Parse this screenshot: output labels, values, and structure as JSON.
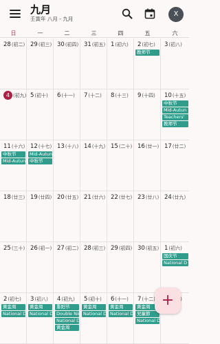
{
  "header": {
    "title": "九月",
    "subtitle": "壬寅年 八月 - 九月",
    "avatar_letter": "X"
  },
  "weekdays": [
    "日",
    "一",
    "二",
    "三",
    "四",
    "五",
    "六"
  ],
  "weeks": [
    [
      {
        "day": "28",
        "lunar": "(初二)"
      },
      {
        "day": "29",
        "lunar": "(初三)"
      },
      {
        "day": "30",
        "lunar": "(初四)"
      },
      {
        "day": "31",
        "lunar": "(初五)"
      },
      {
        "day": "1",
        "lunar": "(初六)"
      },
      {
        "day": "2",
        "lunar": "(初七)",
        "events": [
          "教师节"
        ]
      },
      {
        "day": "3",
        "lunar": "(初八)"
      }
    ],
    [
      {
        "day": "4",
        "lunar": "(初九)",
        "today": true
      },
      {
        "day": "5",
        "lunar": "(初十)"
      },
      {
        "day": "6",
        "lunar": "(十一)"
      },
      {
        "day": "7",
        "lunar": "(十二)"
      },
      {
        "day": "8",
        "lunar": "(十三)"
      },
      {
        "day": "9",
        "lunar": "(十四)"
      },
      {
        "day": "10",
        "lunar": "(十五)",
        "events": [
          "中秋节",
          "Mid-Autun",
          "Teachers'",
          "教师节"
        ]
      }
    ],
    [
      {
        "day": "11",
        "lunar": "(十六)",
        "events": [
          "中秋节",
          "Mid-Autun"
        ]
      },
      {
        "day": "12",
        "lunar": "(十七)",
        "events": [
          "Mid-Autun",
          "中秋节"
        ]
      },
      {
        "day": "13",
        "lunar": "(十八)"
      },
      {
        "day": "14",
        "lunar": "(十九)"
      },
      {
        "day": "15",
        "lunar": "(二十)"
      },
      {
        "day": "16",
        "lunar": "(廿一)"
      },
      {
        "day": "17",
        "lunar": "(廿二)"
      }
    ],
    [
      {
        "day": "18",
        "lunar": "(廿三)"
      },
      {
        "day": "19",
        "lunar": "(廿四)"
      },
      {
        "day": "20",
        "lunar": "(廿五)"
      },
      {
        "day": "21",
        "lunar": "(廿六)"
      },
      {
        "day": "22",
        "lunar": "(廿七)"
      },
      {
        "day": "23",
        "lunar": "(廿八)"
      },
      {
        "day": "24",
        "lunar": "(廿九)"
      }
    ],
    [
      {
        "day": "25",
        "lunar": "(三十)"
      },
      {
        "day": "26",
        "lunar": "(初一)"
      },
      {
        "day": "27",
        "lunar": "(初二)"
      },
      {
        "day": "28",
        "lunar": "(初三)"
      },
      {
        "day": "29",
        "lunar": "(初四)"
      },
      {
        "day": "30",
        "lunar": "(初五)"
      },
      {
        "day": "1",
        "lunar": "(初六)",
        "events": [
          "国庆节",
          "National D"
        ]
      }
    ],
    [
      {
        "day": "2",
        "lunar": "(初七)",
        "events": [
          "黄金周",
          "National D"
        ]
      },
      {
        "day": "3",
        "lunar": "(初八)",
        "events": [
          "黄金周",
          "National D"
        ]
      },
      {
        "day": "4",
        "lunar": "(初九)",
        "events": [
          "重阳节",
          "Double Nin",
          "National D",
          "黄金周"
        ]
      },
      {
        "day": "5",
        "lunar": "(初十)",
        "events": [
          "黄金周",
          "National D"
        ]
      },
      {
        "day": "6",
        "lunar": "(十一)",
        "events": [
          "黄金周",
          "National D"
        ]
      },
      {
        "day": "7",
        "lunar": "(十二)",
        "events": [
          "黄金周",
          "兒童節",
          "National D"
        ]
      },
      {
        "day": "8",
        "lunar": "(十三)"
      }
    ]
  ],
  "colors": {
    "event_chip": "#2f9c8c",
    "today_badge": "#b01e46",
    "sunday_header": "#c0304a",
    "fab_bg": "#fbe0e3"
  },
  "icons": {
    "menu": "menu-icon",
    "search": "search-icon",
    "calendar_today": "calendar-today-icon",
    "add": "plus-icon"
  },
  "fab": {
    "symbol": "+"
  }
}
